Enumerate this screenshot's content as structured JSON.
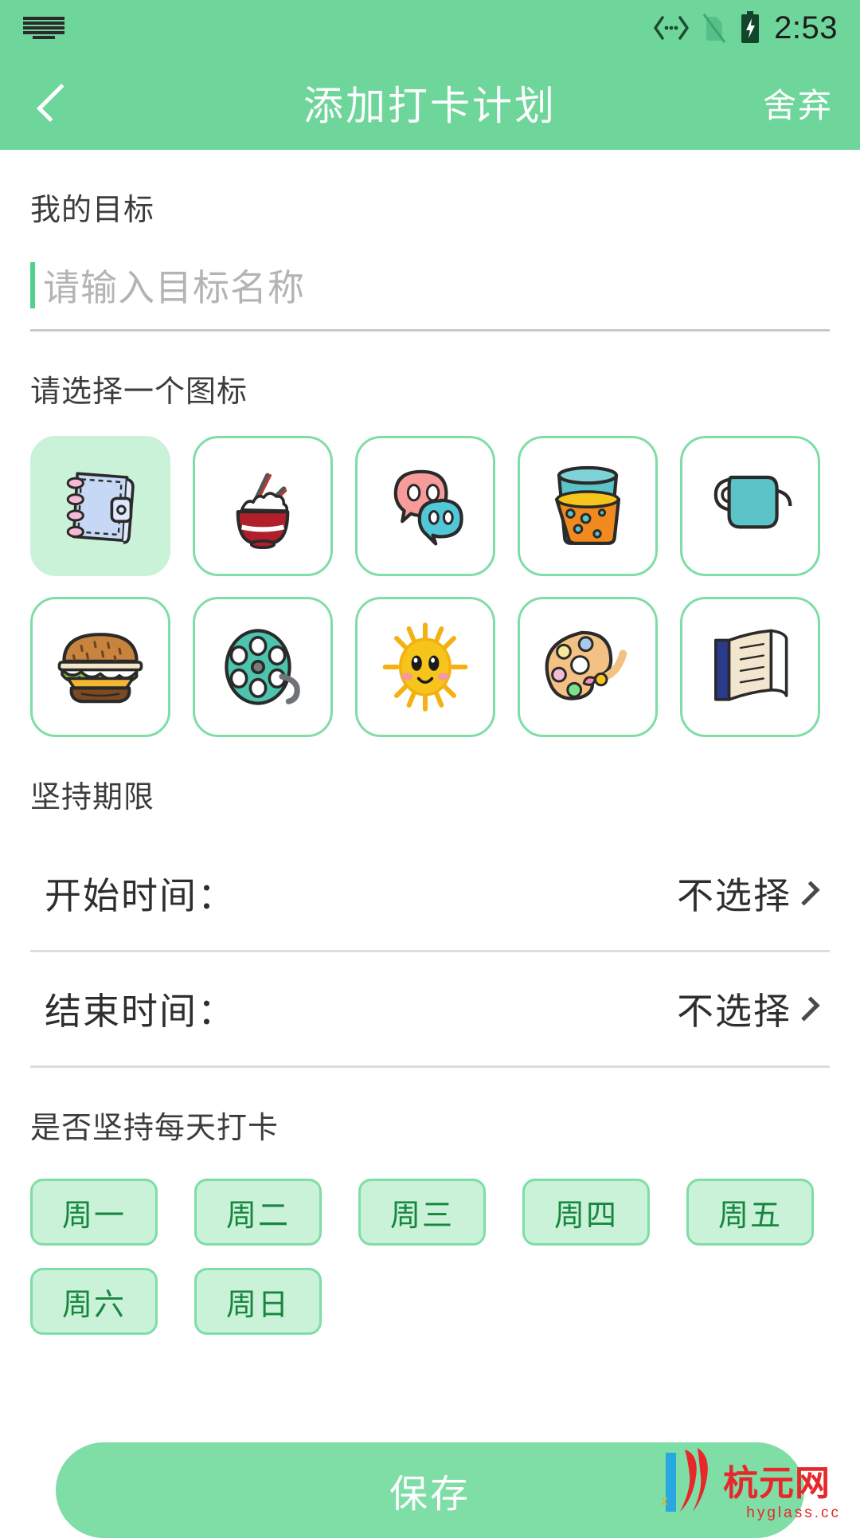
{
  "status_bar": {
    "keyboard_icon": "keyboard-icon",
    "data_transfer_icon": "data-transfer-icon",
    "no_sim_icon": "no-sim-icon",
    "battery_charging_icon": "battery-charging-icon",
    "time": "2:53"
  },
  "app_bar": {
    "back_icon": "back-chevron-icon",
    "title": "添加打卡计划",
    "discard_label": "舍弃"
  },
  "goal_section": {
    "label": "我的目标",
    "placeholder": "请输入目标名称",
    "value": ""
  },
  "icon_section": {
    "label": "请选择一个图标",
    "selected_index": 0,
    "rows": [
      [
        {
          "name": "notebook-icon",
          "label": "笔记本",
          "selected": true
        },
        {
          "name": "rice-bowl-icon",
          "label": "米饭",
          "selected": false
        },
        {
          "name": "chat-bubbles-icon",
          "label": "聊天",
          "selected": false
        },
        {
          "name": "juice-glass-icon",
          "label": "饮料",
          "selected": false
        },
        {
          "name": "teapot-icon",
          "label": "茶壶",
          "selected": false
        }
      ],
      [
        {
          "name": "hamburger-icon",
          "label": "汉堡",
          "selected": false
        },
        {
          "name": "film-reel-icon",
          "label": "电影",
          "selected": false
        },
        {
          "name": "sun-icon",
          "label": "太阳",
          "selected": false
        },
        {
          "name": "paint-palette-icon",
          "label": "画板",
          "selected": false
        },
        {
          "name": "open-book-icon",
          "label": "书本",
          "selected": false
        }
      ]
    ]
  },
  "duration_section": {
    "label": "坚持期限",
    "rows": [
      {
        "label": "开始时间：",
        "value": "不选择",
        "chevron": "chevron-right-icon"
      },
      {
        "label": "结束时间：",
        "value": "不选择",
        "chevron": "chevron-right-icon"
      }
    ]
  },
  "weekday_section": {
    "label": "是否坚持每天打卡",
    "days": [
      "周一",
      "周二",
      "周三",
      "周四",
      "周五",
      "周六",
      "周日"
    ]
  },
  "save_button": {
    "label": "保存"
  },
  "watermark": {
    "text": "杭元网",
    "url": "hyglass.cc"
  },
  "colors": {
    "brand_green": "#6ed69a",
    "chip_green": "#c9f2d8",
    "chip_border": "#7fdda6",
    "chip_text": "#17863f",
    "watermark_red": "#e8272c"
  }
}
